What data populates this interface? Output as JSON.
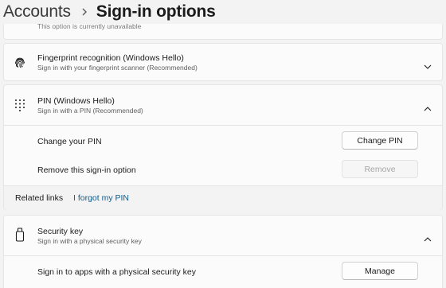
{
  "breadcrumb": {
    "parent": "Accounts",
    "current": "Sign-in options"
  },
  "top_card": {
    "partial_text": "This option is currently unavailable"
  },
  "fingerprint": {
    "title": "Fingerprint recognition (Windows Hello)",
    "subtitle": "Sign in with your fingerprint scanner (Recommended)",
    "icon": "fingerprint-icon",
    "expanded": false
  },
  "pin": {
    "title": "PIN (Windows Hello)",
    "subtitle": "Sign in with a PIN (Recommended)",
    "icon": "keypad-icon",
    "expanded": true,
    "change_label": "Change your PIN",
    "change_button": "Change PIN",
    "remove_label": "Remove this sign-in option",
    "remove_button": "Remove",
    "related_label": "Related links",
    "related_link": "I forgot my PIN"
  },
  "security_key": {
    "title": "Security key",
    "subtitle": "Sign in with a physical security key",
    "icon": "usb-key-icon",
    "expanded": true,
    "manage_label": "Sign in to apps with a physical security key",
    "manage_button": "Manage"
  },
  "colors": {
    "background": "#f3f3f3",
    "card": "#fbfbfb",
    "link": "#0f5c8c",
    "disabled_text": "#a6a6a6"
  }
}
